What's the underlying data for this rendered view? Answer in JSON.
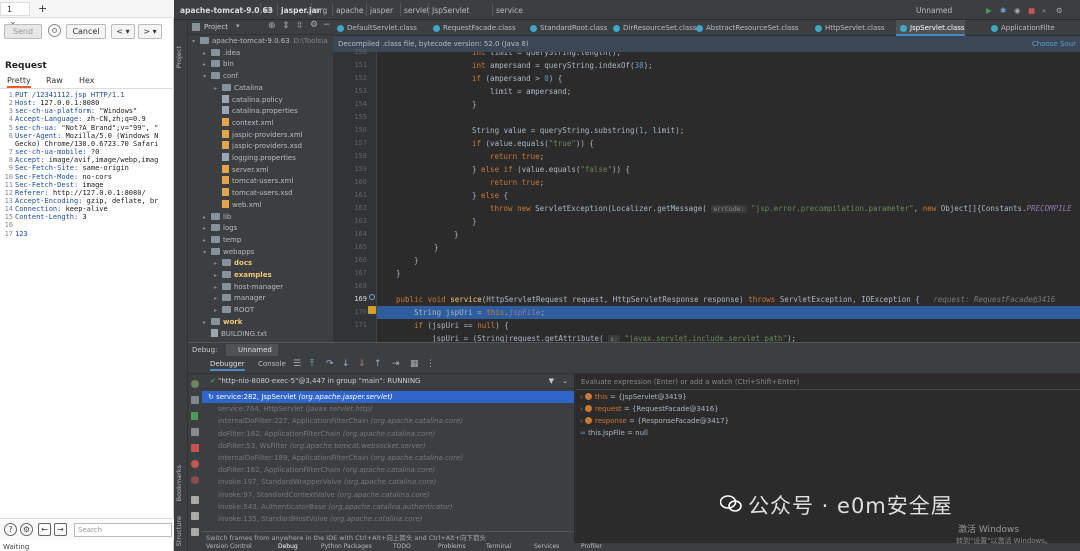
{
  "burp": {
    "tabs": [
      "1",
      "×",
      "+"
    ],
    "toolbar": {
      "send": "Send",
      "cancel": "Cancel",
      "back": "<",
      "fwd": ">"
    },
    "request_title": "Request",
    "subtabs": [
      "Pretty",
      "Raw",
      "Hex"
    ],
    "request_lines": [
      {
        "n": "1",
        "k": "PUT /12341112.jsp HTTP/1.1",
        "v": ""
      },
      {
        "n": "2",
        "k": "Host: ",
        "v": "127.0.0.1:8080"
      },
      {
        "n": "3",
        "k": "sec-ch-ua-platform: ",
        "v": "\"Windows\""
      },
      {
        "n": "4",
        "k": "Accept-Language: ",
        "v": "zh-CN,zh;q=0.9"
      },
      {
        "n": "5",
        "k": "sec-ch-ua: ",
        "v": "\"Not?A_Brand\";v=\"99\", \""
      },
      {
        "n": "6",
        "k": "User-Agent: ",
        "v": "Mozilla/5.0 (Windows N"
      },
      {
        "n": "",
        "k": "",
        "v": "Gecko) Chrome/130.0.6723.70 Safari"
      },
      {
        "n": "7",
        "k": "sec-ch-ua-mobile: ",
        "v": "?0"
      },
      {
        "n": "8",
        "k": "Accept: ",
        "v": "image/avif,image/webp,imag"
      },
      {
        "n": "9",
        "k": "Sec-Fetch-Site: ",
        "v": "same-origin"
      },
      {
        "n": "10",
        "k": "Sec-Fetch-Mode: ",
        "v": "no-cors"
      },
      {
        "n": "11",
        "k": "Sec-Fetch-Dest: ",
        "v": "image"
      },
      {
        "n": "12",
        "k": "Referer: ",
        "v": "http://127.0.0.1:8080/"
      },
      {
        "n": "13",
        "k": "Accept-Encoding: ",
        "v": "gzip, deflate, br"
      },
      {
        "n": "14",
        "k": "Connection: ",
        "v": "keep-alive"
      },
      {
        "n": "15",
        "k": "Content-Length: ",
        "v": "3"
      },
      {
        "n": "16",
        "k": "",
        "v": ""
      },
      {
        "n": "17",
        "k": "123",
        "v": ""
      }
    ],
    "search_placeholder": "Search",
    "waiting": "Waiting"
  },
  "ide": {
    "breadcrumbs": [
      "apache-tomcat-9.0.63",
      "lib",
      "jasper.jar",
      "org",
      "apache",
      "jasper",
      "servlet",
      "JspServlet",
      "service"
    ],
    "run_config": "Unnamed",
    "project_label": "Project",
    "tree": [
      {
        "indent": 0,
        "label": "apache-tomcat-9.0.63",
        "extra": "D:\\Tools\\a",
        "type": "folder",
        "open": true
      },
      {
        "indent": 1,
        "label": ".idea",
        "type": "folder",
        "open": false
      },
      {
        "indent": 1,
        "label": "bin",
        "type": "folder",
        "open": false
      },
      {
        "indent": 1,
        "label": "conf",
        "type": "folder",
        "open": true
      },
      {
        "indent": 2,
        "label": "Catalina",
        "type": "folder",
        "open": false
      },
      {
        "indent": 2,
        "label": "catalina.policy",
        "type": "file"
      },
      {
        "indent": 2,
        "label": "catalina.properties",
        "type": "file"
      },
      {
        "indent": 2,
        "label": "context.xml",
        "type": "xml"
      },
      {
        "indent": 2,
        "label": "jaspic-providers.xml",
        "type": "xml"
      },
      {
        "indent": 2,
        "label": "jaspic-providers.xsd",
        "type": "xml"
      },
      {
        "indent": 2,
        "label": "logging.properties",
        "type": "file"
      },
      {
        "indent": 2,
        "label": "server.xml",
        "type": "xml"
      },
      {
        "indent": 2,
        "label": "tomcat-users.xml",
        "type": "xml"
      },
      {
        "indent": 2,
        "label": "tomcat-users.xsd",
        "type": "xml"
      },
      {
        "indent": 2,
        "label": "web.xml",
        "type": "xml"
      },
      {
        "indent": 1,
        "label": "lib",
        "type": "folder",
        "open": false
      },
      {
        "indent": 1,
        "label": "logs",
        "type": "folder",
        "open": false
      },
      {
        "indent": 1,
        "label": "temp",
        "type": "folder",
        "open": false
      },
      {
        "indent": 1,
        "label": "webapps",
        "type": "folder",
        "open": true
      },
      {
        "indent": 2,
        "label": "docs",
        "type": "folder",
        "open": false,
        "hl": true
      },
      {
        "indent": 2,
        "label": "examples",
        "type": "folder",
        "open": false,
        "hl": true
      },
      {
        "indent": 2,
        "label": "host-manager",
        "type": "folder",
        "open": false
      },
      {
        "indent": 2,
        "label": "manager",
        "type": "folder",
        "open": false
      },
      {
        "indent": 2,
        "label": "ROOT",
        "type": "folder",
        "open": false
      },
      {
        "indent": 1,
        "label": "work",
        "type": "folder",
        "open": false,
        "hl": true
      },
      {
        "indent": 1,
        "label": "BUILDING.txt",
        "type": "file"
      }
    ],
    "editor_tabs": [
      "DefaultServlet.class",
      "RequestFacade.class",
      "StandardRoot.class",
      "DirResourceSet.class",
      "AbstractResourceSet.class",
      "HttpServlet.class",
      "JspServlet.class",
      "ApplicationFilte"
    ],
    "active_tab": 6,
    "decompiled_notice": "Decompiled .class file, bytecode version: 52.0 (Java 8)",
    "choose_sources": "Choose Sour",
    "line_numbers": [
      "150",
      "151",
      "152",
      "153",
      "154",
      "155",
      "156",
      "157",
      "158",
      "159",
      "160",
      "161",
      "162",
      "163",
      "164",
      "165",
      "166",
      "167",
      "168",
      "169",
      "170",
      "171"
    ],
    "debug": {
      "title": "Debug:",
      "config": "Unnamed",
      "tabs": [
        "Debugger",
        "Console"
      ],
      "thread": "\"http-nio-8080-exec-5\"@3,447 in group \"main\": RUNNING",
      "frames": [
        {
          "m": "service:282, JspServlet ",
          "c": "(org.apache.jasper.servlet)",
          "sel": true
        },
        {
          "m": "service:764, HttpServlet ",
          "c": "(javax.servlet.http)"
        },
        {
          "m": "internalDoFilter:227, ApplicationFilterChain ",
          "c": "(org.apache.catalina.core)"
        },
        {
          "m": "doFilter:162, ApplicationFilterChain ",
          "c": "(org.apache.catalina.core)"
        },
        {
          "m": "doFilter:53, WsFilter ",
          "c": "(org.apache.tomcat.websocket.server)"
        },
        {
          "m": "internalDoFilter:189, ApplicationFilterChain ",
          "c": "(org.apache.catalina.core)"
        },
        {
          "m": "doFilter:162, ApplicationFilterChain ",
          "c": "(org.apache.catalina.core)"
        },
        {
          "m": "invoke:197, StandardWrapperValve ",
          "c": "(org.apache.catalina.core)"
        },
        {
          "m": "invoke:97, StandardContextValve ",
          "c": "(org.apache.catalina.core)"
        },
        {
          "m": "invoke:543, AuthenticatorBase ",
          "c": "(org.apache.catalina.authenticator)"
        },
        {
          "m": "invoke:135, StandardHostValve ",
          "c": "(org.apache.catalina.core)"
        }
      ],
      "eval_placeholder": "Evaluate expression (Enter) or add a watch (Ctrl+Shift+Enter)",
      "vars": [
        {
          "name": "this",
          "val": " = {JspServlet@3419}"
        },
        {
          "name": "request",
          "val": " = {RequestFacade@3416}"
        },
        {
          "name": "response",
          "val": " = {ResponseFacade@3417}"
        },
        {
          "name": "this.jspFile",
          "val": " = null",
          "plain": true
        }
      ],
      "hint": "Switch frames from anywhere in the IDE with Ctrl+Alt+向上箭头 and Ctrl+Alt+向下箭头"
    },
    "status": [
      "Version Control",
      "Debug",
      "Python Packages",
      "TODO",
      "Problems",
      "Terminal",
      "Services",
      "Profiler"
    ],
    "side_labels": [
      "Project",
      "Bookmarks",
      "Structure"
    ]
  },
  "overlay": {
    "watermark": "公众号 · e0m安全屋",
    "win_activate": "激活 Windows",
    "win_hint": "转到\"设置\"以激活 Windows。"
  },
  "colors": {
    "accent": "#e8612c",
    "exec_line": "#2d5d9c",
    "selection": "#2f65ca"
  }
}
